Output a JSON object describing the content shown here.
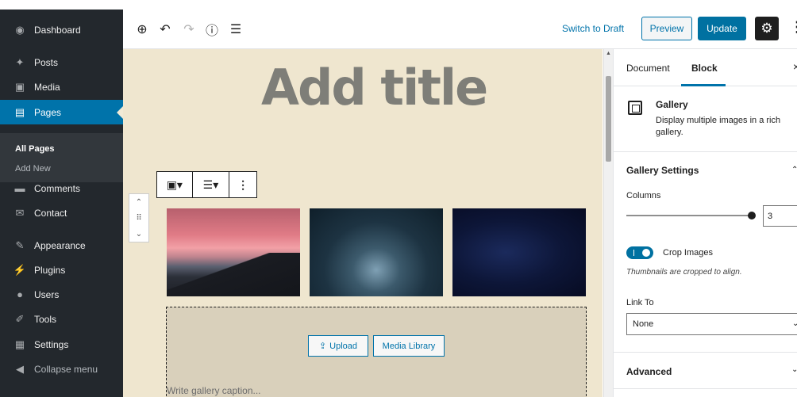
{
  "sidebar": {
    "items": [
      {
        "label": "Dashboard",
        "icon": "dashboard-icon",
        "glyph": "◉"
      },
      {
        "label": "Posts",
        "icon": "pushpin-icon",
        "glyph": "✦"
      },
      {
        "label": "Media",
        "icon": "media-icon",
        "glyph": "▣"
      },
      {
        "label": "Pages",
        "icon": "pages-icon",
        "glyph": "▤"
      },
      {
        "label": "Comments",
        "icon": "comment-icon",
        "glyph": "▬"
      },
      {
        "label": "Contact",
        "icon": "mail-icon",
        "glyph": "✉"
      },
      {
        "label": "Appearance",
        "icon": "paintbrush-icon",
        "glyph": "✎"
      },
      {
        "label": "Plugins",
        "icon": "plugin-icon",
        "glyph": "⚡"
      },
      {
        "label": "Users",
        "icon": "users-icon",
        "glyph": "●"
      },
      {
        "label": "Tools",
        "icon": "wrench-icon",
        "glyph": "✐"
      },
      {
        "label": "Settings",
        "icon": "settings-icon",
        "glyph": "▦"
      },
      {
        "label": "Collapse menu",
        "icon": "collapse-icon",
        "glyph": "◀"
      }
    ],
    "submenu": [
      "All Pages",
      "Add New"
    ],
    "active": "Pages",
    "accent": "#0073aa"
  },
  "toolbar": {
    "icons": [
      "add-block-icon",
      "undo-icon",
      "redo-icon",
      "info-icon",
      "list-view-icon"
    ],
    "switch_draft": "Switch to Draft",
    "preview": "Preview",
    "update": "Update"
  },
  "editor": {
    "title_placeholder": "Add title",
    "upload": "Upload",
    "media_library": "Media Library",
    "caption_placeholder": "Write gallery caption..."
  },
  "panel": {
    "tabs": [
      "Document",
      "Block"
    ],
    "active_tab": "Block",
    "block_name": "Gallery",
    "block_description": "Display multiple images in a rich gallery.",
    "gallery_settings": "Gallery Settings",
    "columns_label": "Columns",
    "columns_value": "3",
    "columns_fraction": 0.96,
    "crop_label": "Crop Images",
    "crop_enabled": true,
    "crop_help": "Thumbnails are cropped to align.",
    "link_to_label": "Link To",
    "link_to_value": "None",
    "advanced": "Advanced"
  }
}
